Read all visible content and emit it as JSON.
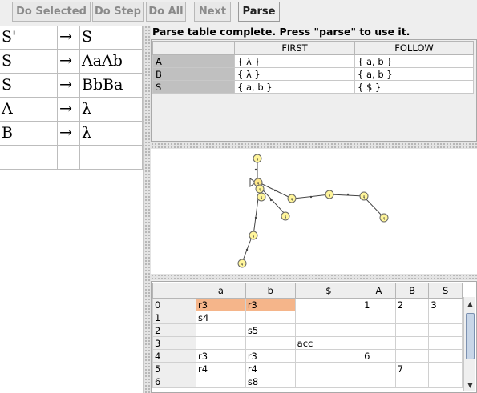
{
  "toolbar": {
    "do_selected": "Do Selected",
    "do_step": "Do Step",
    "do_all": "Do All",
    "next": "Next",
    "parse": "Parse"
  },
  "grammar": {
    "arrow": "→",
    "rows": [
      {
        "lhs": "S'",
        "rhs": "S"
      },
      {
        "lhs": "S",
        "rhs": "AaAb"
      },
      {
        "lhs": "S",
        "rhs": "BbBa"
      },
      {
        "lhs": "A",
        "rhs": "λ"
      },
      {
        "lhs": "B",
        "rhs": "λ"
      },
      {
        "lhs": "",
        "rhs": ""
      }
    ]
  },
  "status": "Parse table complete.  Press \"parse\" to use it.",
  "first_follow": {
    "headers": [
      "",
      "FIRST",
      "FOLLOW"
    ],
    "rows": [
      {
        "symbol": "A",
        "first": "{ λ }",
        "follow": "{ a, b }"
      },
      {
        "symbol": "B",
        "first": "{ λ }",
        "follow": "{ a, b }"
      },
      {
        "symbol": "S",
        "first": "{ a, b }",
        "follow": "{ $ }"
      }
    ]
  },
  "graph": {
    "node_color": "#fff59b",
    "selected_color": "#ffe88a",
    "node_label": "q"
  },
  "action_table": {
    "headers": [
      "",
      "a",
      "b",
      "$",
      "A",
      "B",
      "S"
    ],
    "highlight_color": "#f5b58a",
    "rows": [
      [
        "0",
        "r3",
        "r3",
        "",
        "1",
        "2",
        "3"
      ],
      [
        "1",
        "s4",
        "",
        "",
        "",
        "",
        ""
      ],
      [
        "2",
        "",
        "s5",
        "",
        "",
        "",
        ""
      ],
      [
        "3",
        "",
        "",
        "acc",
        "",
        "",
        ""
      ],
      [
        "4",
        "r3",
        "r3",
        "",
        "6",
        "",
        ""
      ],
      [
        "5",
        "r4",
        "r4",
        "",
        "",
        "7",
        ""
      ],
      [
        "6",
        "",
        "s8",
        "",
        "",
        "",
        ""
      ]
    ],
    "highlighted": [
      [
        0,
        1
      ],
      [
        0,
        2
      ]
    ]
  }
}
